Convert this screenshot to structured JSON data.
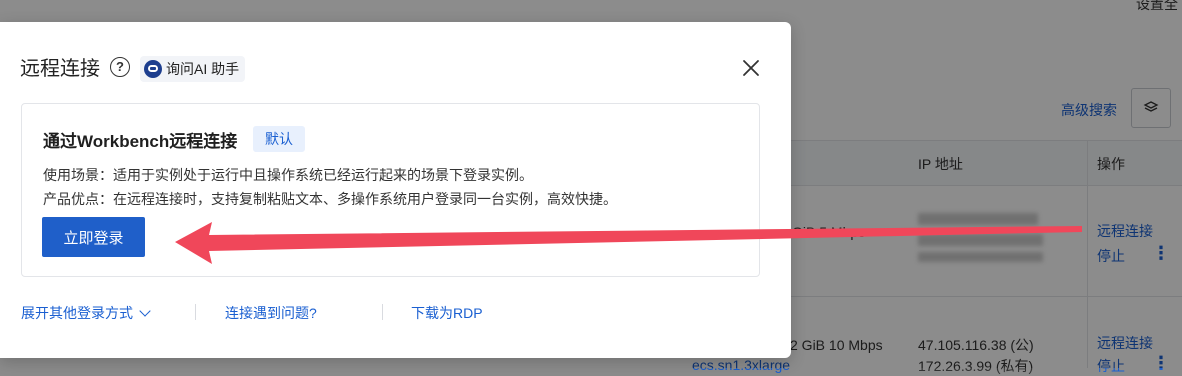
{
  "background": {
    "top_right_text": "设置全",
    "advanced_search": "高级搜索",
    "col_ip": "IP 地址",
    "col_actions": "操作",
    "row1": {
      "spec_tail": "GiB 5 Mbps",
      "action_remote": "远程连接",
      "action_stop": "停止",
      "action_more": "⋮"
    },
    "row2": {
      "spec_tail": "2 GiB 10 Mbps",
      "ip_public": "47.105.116.38 (公)",
      "ip_private": "172.26.3.99 (私有)",
      "instance_type": "ecs.sn1.3xlarge",
      "action_remote": "远程连接",
      "action_stop": "停止",
      "action_more": "⋮"
    }
  },
  "modal": {
    "title": "远程连接",
    "help_glyph": "?",
    "ai_assistant": "询问AI 助手",
    "card": {
      "title": "通过Workbench远程连接",
      "badge": "默认",
      "scenario": "使用场景：适用于实例处于运行中且操作系统已经运行起来的场景下登录实例。",
      "advantage": "产品优点：在远程连接时，支持复制粘贴文本、多操作系统用户登录同一台实例，高效快捷。",
      "login_button": "立即登录"
    },
    "footer": {
      "expand_other": "展开其他登录方式",
      "connection_issue": "连接遇到问题?",
      "download_rdp": "下载为RDP"
    }
  },
  "colors": {
    "primary": "#1f5fc9",
    "link": "#1a5fd1",
    "arrow": "#f0475a"
  }
}
